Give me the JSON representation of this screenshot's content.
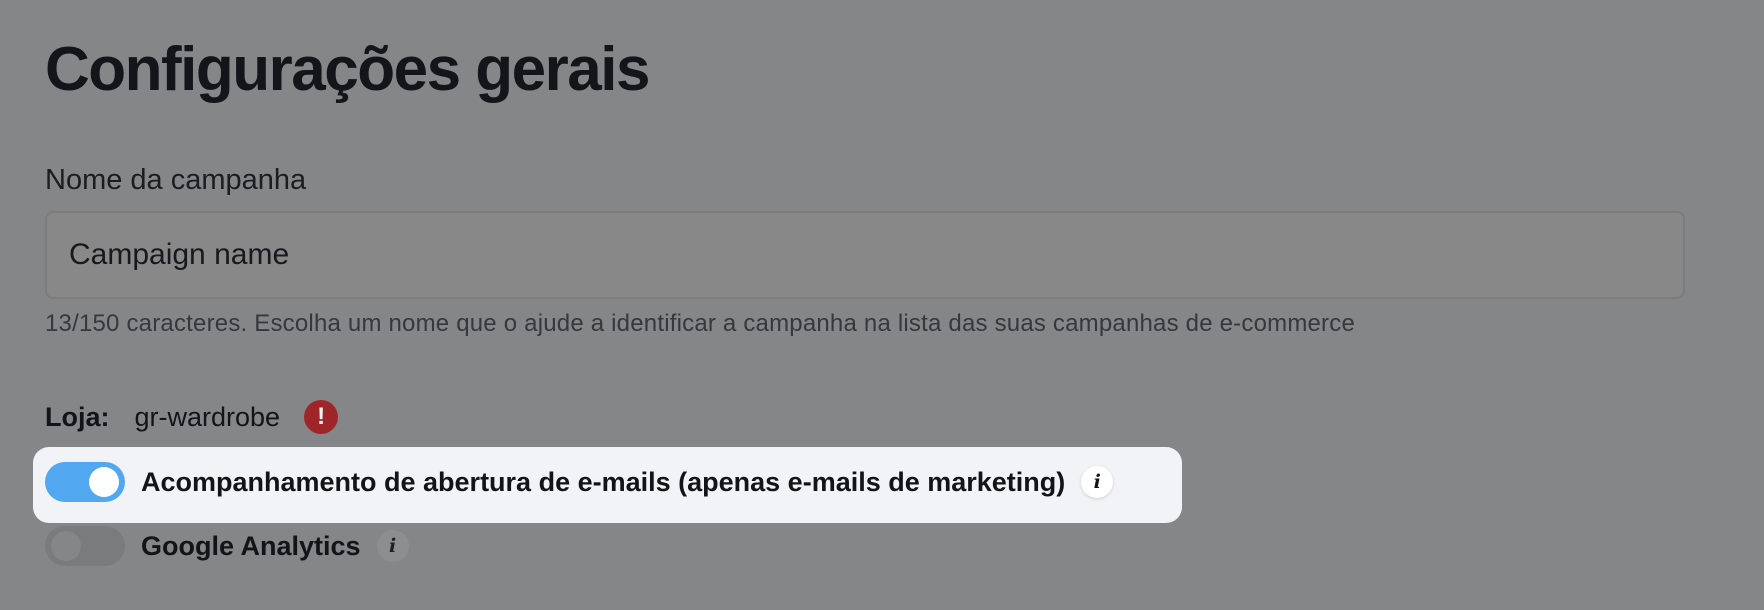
{
  "page": {
    "title": "Configurações gerais"
  },
  "campaign_name": {
    "label": "Nome da campanha",
    "value": "Campaign name",
    "help": "13/150 caracteres. Escolha um nome que o ajude a identificar a campanha na lista das suas campanhas de e-commerce"
  },
  "store": {
    "label": "Loja:",
    "name": "gr-wardrobe",
    "warning_icon": "exclamation-circle-icon",
    "warning_color": "#9e2628"
  },
  "toggles": [
    {
      "label": "Acompanhamento de abertura de e-mails (apenas e-mails de marketing)",
      "enabled": true,
      "info_icon": "info-icon"
    },
    {
      "label": "Google Analytics",
      "enabled": false,
      "info_icon": "info-icon"
    }
  ],
  "colors": {
    "overlay_background": "#858688",
    "toggle_on": "#52a8f0",
    "highlight_background": "#f2f3f6"
  }
}
